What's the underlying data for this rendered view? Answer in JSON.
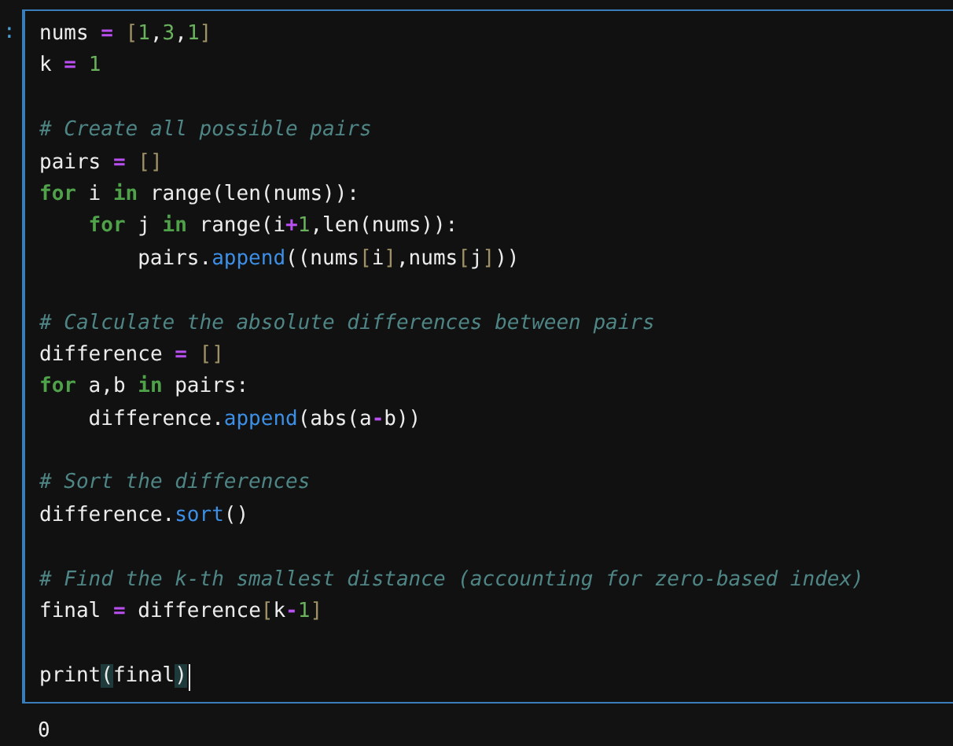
{
  "cell": {
    "prompt": ":",
    "lines": [
      {
        "kind": "code",
        "tokens": [
          {
            "text": "nums ",
            "kind": "plain"
          },
          {
            "text": "= ",
            "kind": "op"
          },
          {
            "text": "[",
            "kind": "bracket"
          },
          {
            "text": "1",
            "kind": "num"
          },
          {
            "text": ",",
            "kind": "plain"
          },
          {
            "text": "3",
            "kind": "num"
          },
          {
            "text": ",",
            "kind": "plain"
          },
          {
            "text": "1",
            "kind": "num"
          },
          {
            "text": "]",
            "kind": "bracket"
          }
        ]
      },
      {
        "kind": "code",
        "tokens": [
          {
            "text": "k ",
            "kind": "plain"
          },
          {
            "text": "= ",
            "kind": "op"
          },
          {
            "text": "1",
            "kind": "num"
          }
        ]
      },
      {
        "kind": "blank"
      },
      {
        "kind": "code",
        "tokens": [
          {
            "text": "# Create all possible pairs",
            "kind": "comment"
          }
        ]
      },
      {
        "kind": "code",
        "tokens": [
          {
            "text": "pairs ",
            "kind": "plain"
          },
          {
            "text": "= ",
            "kind": "op"
          },
          {
            "text": "[]",
            "kind": "bracket"
          }
        ]
      },
      {
        "kind": "code",
        "tokens": [
          {
            "text": "for",
            "kind": "kw"
          },
          {
            "text": " i ",
            "kind": "plain"
          },
          {
            "text": "in",
            "kind": "kw"
          },
          {
            "text": " range(len(nums)):",
            "kind": "plain"
          }
        ],
        "children": [
          {
            "kind": "code",
            "tokens": [
              {
                "text": "for",
                "kind": "kw"
              },
              {
                "text": " j ",
                "kind": "plain"
              },
              {
                "text": "in",
                "kind": "kw"
              },
              {
                "text": " range(i",
                "kind": "plain"
              },
              {
                "text": "+",
                "kind": "op"
              },
              {
                "text": "1",
                "kind": "num"
              },
              {
                "text": ",len(nums)):",
                "kind": "plain"
              }
            ],
            "children": [
              {
                "kind": "code",
                "tokens": [
                  {
                    "text": "pairs.",
                    "kind": "plain"
                  },
                  {
                    "text": "append",
                    "kind": "func"
                  },
                  {
                    "text": "((nums",
                    "kind": "plain"
                  },
                  {
                    "text": "[",
                    "kind": "bracket"
                  },
                  {
                    "text": "i",
                    "kind": "plain"
                  },
                  {
                    "text": "]",
                    "kind": "bracket"
                  },
                  {
                    "text": ",nums",
                    "kind": "plain"
                  },
                  {
                    "text": "[",
                    "kind": "bracket"
                  },
                  {
                    "text": "j",
                    "kind": "plain"
                  },
                  {
                    "text": "]",
                    "kind": "bracket"
                  },
                  {
                    "text": "))",
                    "kind": "plain"
                  }
                ]
              }
            ]
          }
        ]
      },
      {
        "kind": "blank"
      },
      {
        "kind": "code",
        "tokens": [
          {
            "text": "# Calculate the absolute differences between pairs",
            "kind": "comment"
          }
        ]
      },
      {
        "kind": "code",
        "tokens": [
          {
            "text": "difference ",
            "kind": "plain"
          },
          {
            "text": "= ",
            "kind": "op"
          },
          {
            "text": "[]",
            "kind": "bracket"
          }
        ]
      },
      {
        "kind": "code",
        "tokens": [
          {
            "text": "for",
            "kind": "kw"
          },
          {
            "text": " a,b ",
            "kind": "plain"
          },
          {
            "text": "in",
            "kind": "kw"
          },
          {
            "text": " pairs:",
            "kind": "plain"
          }
        ],
        "children": [
          {
            "kind": "code",
            "tokens": [
              {
                "text": "difference.",
                "kind": "plain"
              },
              {
                "text": "append",
                "kind": "func"
              },
              {
                "text": "(abs(a",
                "kind": "plain"
              },
              {
                "text": "-",
                "kind": "op"
              },
              {
                "text": "b))",
                "kind": "plain"
              }
            ]
          }
        ]
      },
      {
        "kind": "blank"
      },
      {
        "kind": "code",
        "tokens": [
          {
            "text": "# Sort the differences",
            "kind": "comment"
          }
        ]
      },
      {
        "kind": "code",
        "tokens": [
          {
            "text": "difference.",
            "kind": "plain"
          },
          {
            "text": "sort",
            "kind": "func"
          },
          {
            "text": "()",
            "kind": "plain"
          }
        ]
      },
      {
        "kind": "blank"
      },
      {
        "kind": "code",
        "tokens": [
          {
            "text": "# Find the k-th smallest distance (accounting for zero-based index)",
            "kind": "comment"
          }
        ]
      },
      {
        "kind": "code",
        "tokens": [
          {
            "text": "final ",
            "kind": "plain"
          },
          {
            "text": "=",
            "kind": "op"
          },
          {
            "text": " difference",
            "kind": "plain"
          },
          {
            "text": "[",
            "kind": "bracket"
          },
          {
            "text": "k",
            "kind": "plain"
          },
          {
            "text": "-",
            "kind": "op"
          },
          {
            "text": "1",
            "kind": "num"
          },
          {
            "text": "]",
            "kind": "bracket"
          }
        ]
      },
      {
        "kind": "blank"
      },
      {
        "kind": "code",
        "cursor": true,
        "tokens": [
          {
            "text": "print",
            "kind": "plain"
          },
          {
            "text": "(",
            "kind": "match"
          },
          {
            "text": "final",
            "kind": "plain"
          },
          {
            "text": ")",
            "kind": "match"
          }
        ]
      }
    ]
  },
  "output": "0"
}
